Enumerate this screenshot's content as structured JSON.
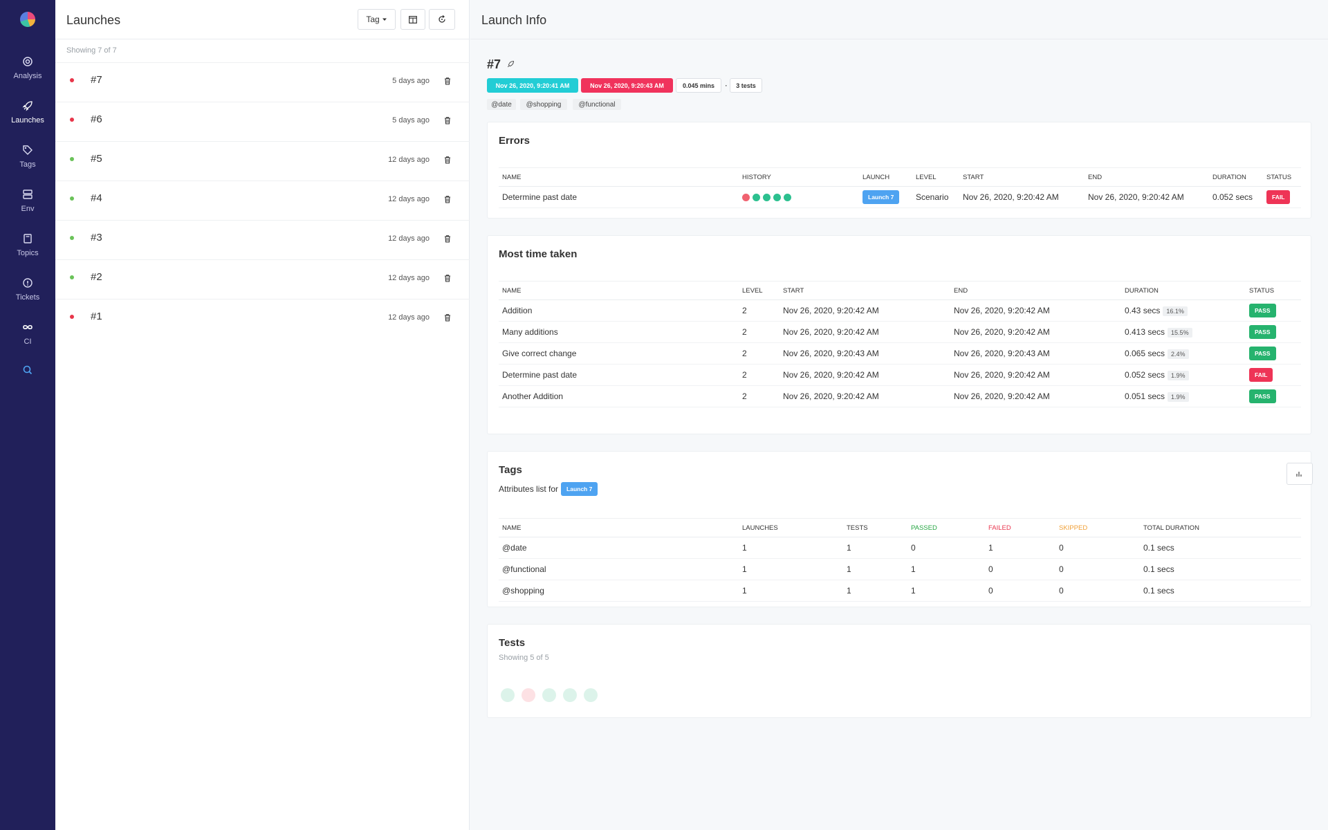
{
  "sidebar": {
    "items": [
      {
        "label": "Analysis",
        "icon": "target-icon"
      },
      {
        "label": "Launches",
        "icon": "rocket-icon"
      },
      {
        "label": "Tags",
        "icon": "tag-icon"
      },
      {
        "label": "Env",
        "icon": "server-icon"
      },
      {
        "label": "Topics",
        "icon": "book-icon"
      },
      {
        "label": "Tickets",
        "icon": "alert-circle-icon"
      },
      {
        "label": "CI",
        "icon": "infinity-icon"
      }
    ],
    "search_icon": "search-icon"
  },
  "launches_panel": {
    "title": "Launches",
    "tag_button": "Tag",
    "showing": "Showing 7 of 7",
    "launches": [
      {
        "name": "#7",
        "ago": "5 days ago",
        "status": "fail"
      },
      {
        "name": "#6",
        "ago": "5 days ago",
        "status": "fail"
      },
      {
        "name": "#5",
        "ago": "12 days ago",
        "status": "pass"
      },
      {
        "name": "#4",
        "ago": "12 days ago",
        "status": "pass"
      },
      {
        "name": "#3",
        "ago": "12 days ago",
        "status": "pass"
      },
      {
        "name": "#2",
        "ago": "12 days ago",
        "status": "pass"
      },
      {
        "name": "#1",
        "ago": "12 days ago",
        "status": "fail"
      }
    ]
  },
  "launch_info": {
    "title": "Launch Info",
    "id": "#7",
    "start_time": "Nov 26, 2020, 9:20:41 AM",
    "end_time": "Nov 26, 2020, 9:20:43 AM",
    "duration": "0.045 mins",
    "separator": "·",
    "tests_count": "3 tests",
    "tags": [
      "@date",
      "@shopping",
      "@functional"
    ]
  },
  "errors": {
    "title": "Errors",
    "headers": [
      "Name",
      "History",
      "Launch",
      "Level",
      "Start",
      "End",
      "Duration",
      "Status"
    ],
    "rows": [
      {
        "name": "Determine past date",
        "history": [
          "fail",
          "pass",
          "pass",
          "pass",
          "pass"
        ],
        "launch": "Launch 7",
        "level": "Scenario",
        "start": "Nov 26, 2020, 9:20:42 AM",
        "end": "Nov 26, 2020, 9:20:42 AM",
        "duration": "0.052 secs",
        "status": "FAIL"
      }
    ]
  },
  "most_time": {
    "title": "Most time taken",
    "headers": [
      "Name",
      "Level",
      "Start",
      "End",
      "Duration",
      "Status"
    ],
    "rows": [
      {
        "name": "Addition",
        "level": "2",
        "start": "Nov 26, 2020, 9:20:42 AM",
        "end": "Nov 26, 2020, 9:20:42 AM",
        "duration": "0.43 secs",
        "pct": "16.1%",
        "status": "PASS"
      },
      {
        "name": "Many additions",
        "level": "2",
        "start": "Nov 26, 2020, 9:20:42 AM",
        "end": "Nov 26, 2020, 9:20:42 AM",
        "duration": "0.413 secs",
        "pct": "15.5%",
        "status": "PASS"
      },
      {
        "name": "Give correct change",
        "level": "2",
        "start": "Nov 26, 2020, 9:20:43 AM",
        "end": "Nov 26, 2020, 9:20:43 AM",
        "duration": "0.065 secs",
        "pct": "2.4%",
        "status": "PASS"
      },
      {
        "name": "Determine past date",
        "level": "2",
        "start": "Nov 26, 2020, 9:20:42 AM",
        "end": "Nov 26, 2020, 9:20:42 AM",
        "duration": "0.052 secs",
        "pct": "1.9%",
        "status": "FAIL"
      },
      {
        "name": "Another Addition",
        "level": "2",
        "start": "Nov 26, 2020, 9:20:42 AM",
        "end": "Nov 26, 2020, 9:20:42 AM",
        "duration": "0.051 secs",
        "pct": "1.9%",
        "status": "PASS"
      }
    ]
  },
  "tags_card": {
    "title": "Tags",
    "subtitle": "Attributes list for",
    "launch_badge": "Launch 7",
    "headers": [
      "Name",
      "Launches",
      "Tests",
      "Passed",
      "Failed",
      "Skipped",
      "Total Duration"
    ],
    "rows": [
      {
        "name": "@date",
        "launches": "1",
        "tests": "1",
        "passed": "0",
        "failed": "1",
        "skipped": "0",
        "duration": "0.1 secs"
      },
      {
        "name": "@functional",
        "launches": "1",
        "tests": "1",
        "passed": "1",
        "failed": "0",
        "skipped": "0",
        "duration": "0.1 secs"
      },
      {
        "name": "@shopping",
        "launches": "1",
        "tests": "1",
        "passed": "1",
        "failed": "0",
        "skipped": "0",
        "duration": "0.1 secs"
      }
    ]
  },
  "tests_card": {
    "title": "Tests",
    "showing": "Showing 5 of 5",
    "results": [
      "pass",
      "fail",
      "pass",
      "pass",
      "pass"
    ]
  },
  "colors": {
    "sidebar_bg": "#21205a",
    "pass": "#26b36e",
    "fail": "#ee3456",
    "fail_dot": "#e8364a",
    "pass_dot": "#6ac259",
    "start_pill": "#22cdd5",
    "end_pill": "#f0335c",
    "launch_badge": "#4ea3f1",
    "passed_header": "#28a745",
    "failed_header": "#e9374f",
    "skipped_header": "#f0a038",
    "history_pass": "#2cc08f",
    "history_fail": "#f06270"
  }
}
